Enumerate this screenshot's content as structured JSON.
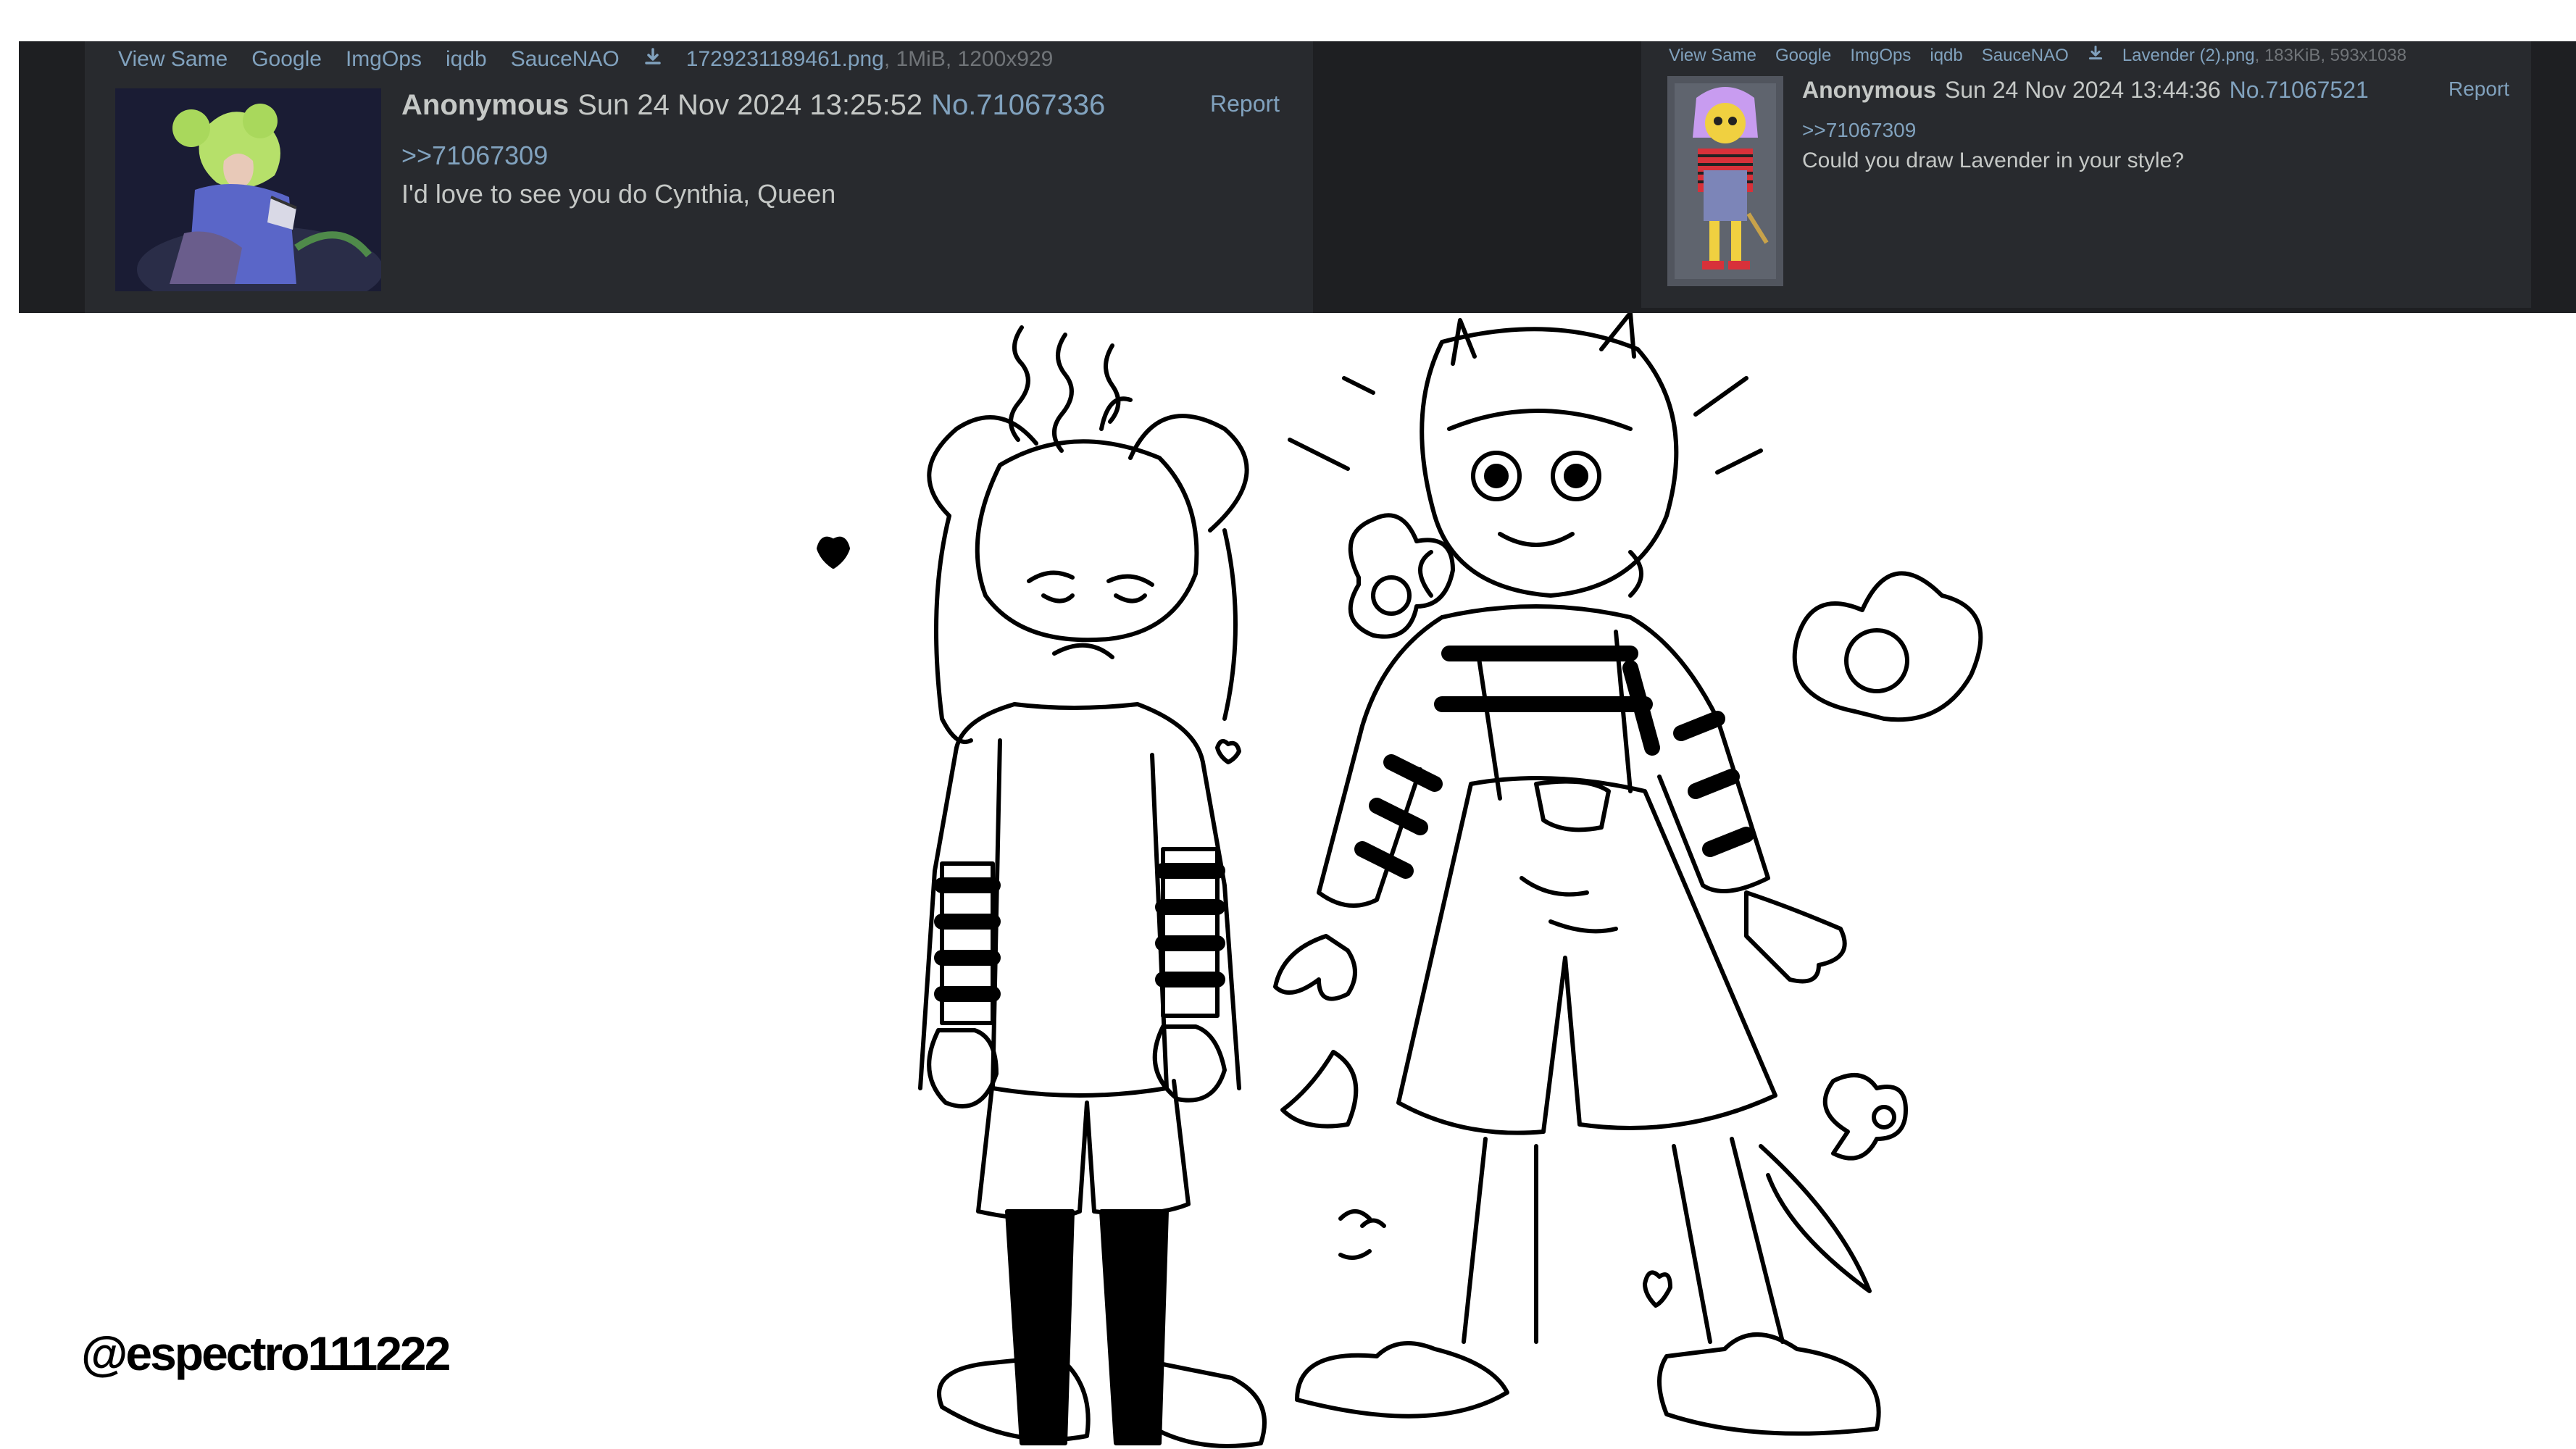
{
  "posts": {
    "left": {
      "file_links": [
        "View Same",
        "Google",
        "ImgOps",
        "iqdb",
        "SauceNAO"
      ],
      "filename": "1729231189461.png",
      "file_meta": ", 1MiB, 1200x929",
      "name": "Anonymous",
      "date": "Sun 24 Nov 2024 13:25:52",
      "post_number": "No.71067336",
      "report_label": "Report",
      "quote_link": ">>71067309",
      "message": "I'd love to see you do Cynthia, Queen"
    },
    "right": {
      "file_links": [
        "View Same",
        "Google",
        "ImgOps",
        "iqdb",
        "SauceNAO"
      ],
      "filename": "Lavender (2).png",
      "file_meta": ", 183KiB, 593x1038",
      "name": "Anonymous",
      "date": "Sun 24 Nov 2024 13:44:36",
      "post_number": "No.71067521",
      "report_label": "Report",
      "quote_link": ">>71067309",
      "message": "Could you draw Lavender in your style?"
    }
  },
  "icons": {
    "download": "download-icon"
  },
  "colors": {
    "page_bg": "#ffffff",
    "bar_bg": "#1e1f22",
    "post_bg": "#282a2e",
    "text": "#c5c8c6",
    "link": "#81a2be",
    "meta": "#707478"
  },
  "watermark": "@espectro111222"
}
